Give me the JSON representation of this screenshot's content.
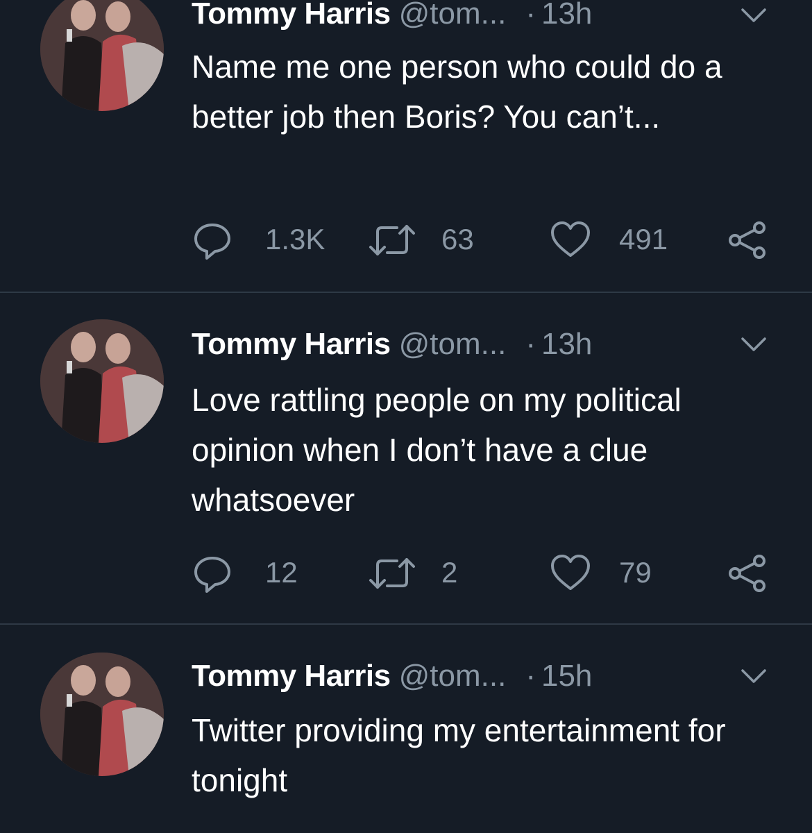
{
  "colors": {
    "background": "#151c26",
    "text_primary": "#ffffff",
    "text_secondary": "#8b98a5",
    "divider": "#2e3945"
  },
  "tweets": [
    {
      "name": "Tommy Harris",
      "handle": "@tom...",
      "separator": "·",
      "time": "13h",
      "text": "Name me one person who could do a better job then Boris? You can’t...",
      "replies": "1.3K",
      "retweets": "63",
      "likes": "491",
      "icons": [
        "reply-icon",
        "retweet-icon",
        "like-icon",
        "share-icon",
        "chevron-down-icon"
      ]
    },
    {
      "name": "Tommy Harris",
      "handle": "@tom...",
      "separator": "·",
      "time": "13h",
      "text": "Love rattling people on my political opinion when I don’t have a clue whatsoever",
      "replies": "12",
      "retweets": "2",
      "likes": "79",
      "icons": [
        "reply-icon",
        "retweet-icon",
        "like-icon",
        "share-icon",
        "chevron-down-icon"
      ]
    },
    {
      "name": "Tommy Harris",
      "handle": "@tom...",
      "separator": "·",
      "time": "15h",
      "text": "Twitter providing my entertainment for tonight",
      "icons": [
        "chevron-down-icon"
      ]
    }
  ]
}
